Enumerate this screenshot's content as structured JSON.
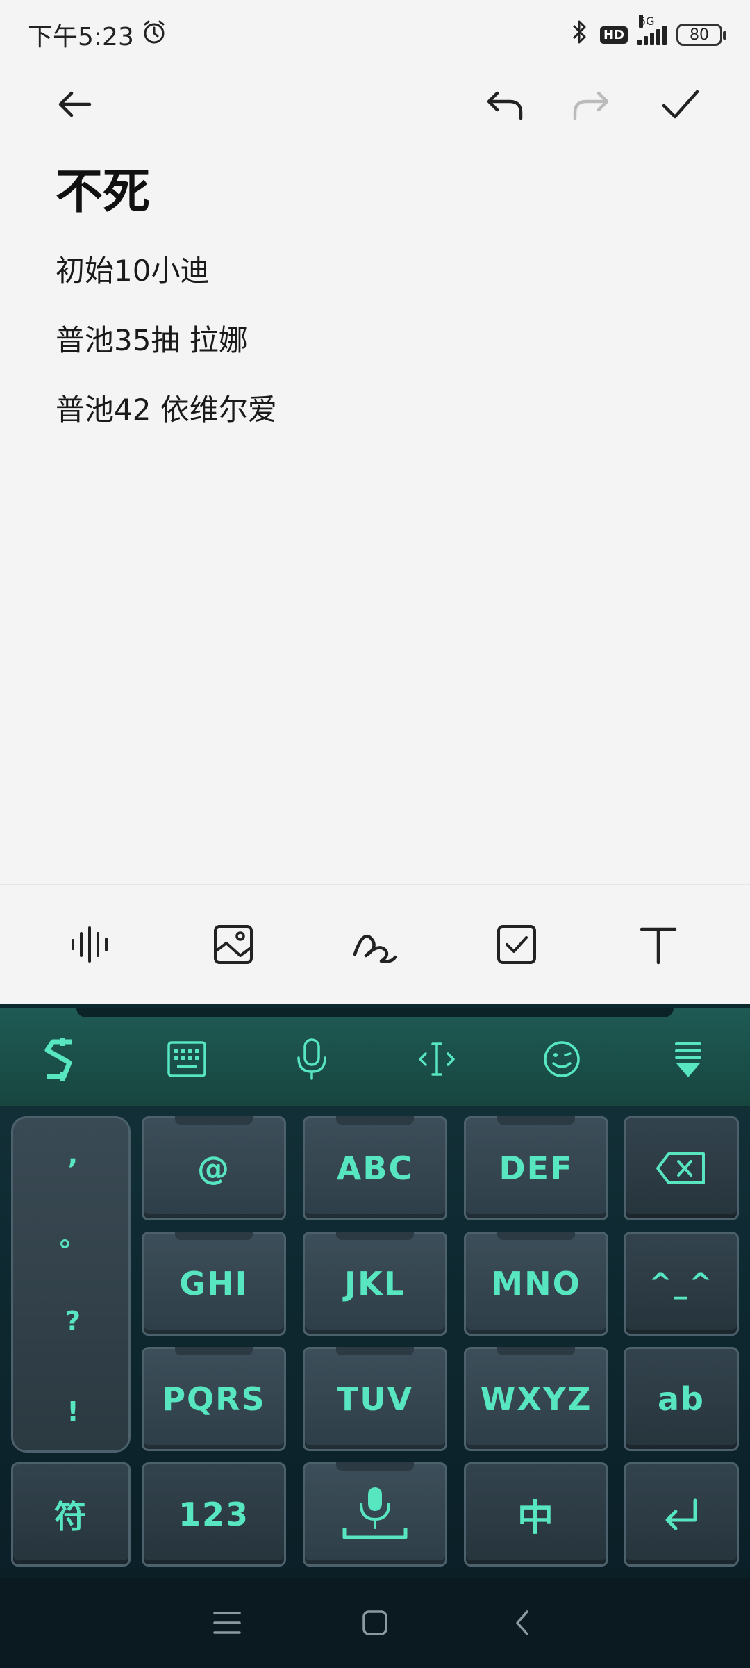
{
  "status_bar": {
    "time": "下午5:23",
    "network_type": "5G",
    "hd_label": "HD",
    "battery": "80"
  },
  "note": {
    "title": "不死",
    "lines": [
      "初始10小迪",
      "普池35抽 拉娜",
      "普池42 依维尔爱"
    ]
  },
  "keyboard": {
    "keys": {
      "at": "@",
      "abc": "ABC",
      "def": "DEF",
      "ghi": "GHI",
      "jkl": "JKL",
      "mno": "MNO",
      "pqrs": "PQRS",
      "tuv": "TUV",
      "wxyz": "WXYZ",
      "emoticon": "^_^",
      "ab": "ab",
      "symbols": "符",
      "numbers": "123",
      "chinese": "中"
    },
    "side_punct": [
      ",",
      "。",
      "?",
      "!"
    ],
    "accent_color": "#57e6c0"
  }
}
